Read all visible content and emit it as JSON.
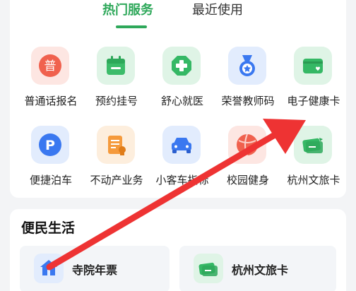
{
  "tabs": {
    "hot": "热门服务",
    "recent": "最近使用"
  },
  "services": [
    {
      "label": "普通话报名",
      "icon": "pu-icon",
      "glyph": "普"
    },
    {
      "label": "预约挂号",
      "icon": "calendar-icon"
    },
    {
      "label": "舒心就医",
      "icon": "medical-cross-icon"
    },
    {
      "label": "荣誉教师码",
      "icon": "medal-icon"
    },
    {
      "label": "电子健康卡",
      "icon": "health-card-icon"
    },
    {
      "label": "便捷泊车",
      "icon": "parking-icon",
      "glyph": "P"
    },
    {
      "label": "不动产业务",
      "icon": "property-document-icon"
    },
    {
      "label": "小客车指标",
      "icon": "car-icon"
    },
    {
      "label": "校园健身",
      "icon": "fitness-ball-icon"
    },
    {
      "label": "杭州文旅卡",
      "icon": "travel-card-icon"
    }
  ],
  "section": {
    "title": "便民生活"
  },
  "tiles": [
    {
      "label": "寺院年票",
      "icon": "temple-icon"
    },
    {
      "label": "杭州文旅卡",
      "icon": "travel-card-icon"
    }
  ],
  "colors": {
    "accent": "#2ea85a",
    "annotation_arrow": "#ee3333"
  }
}
